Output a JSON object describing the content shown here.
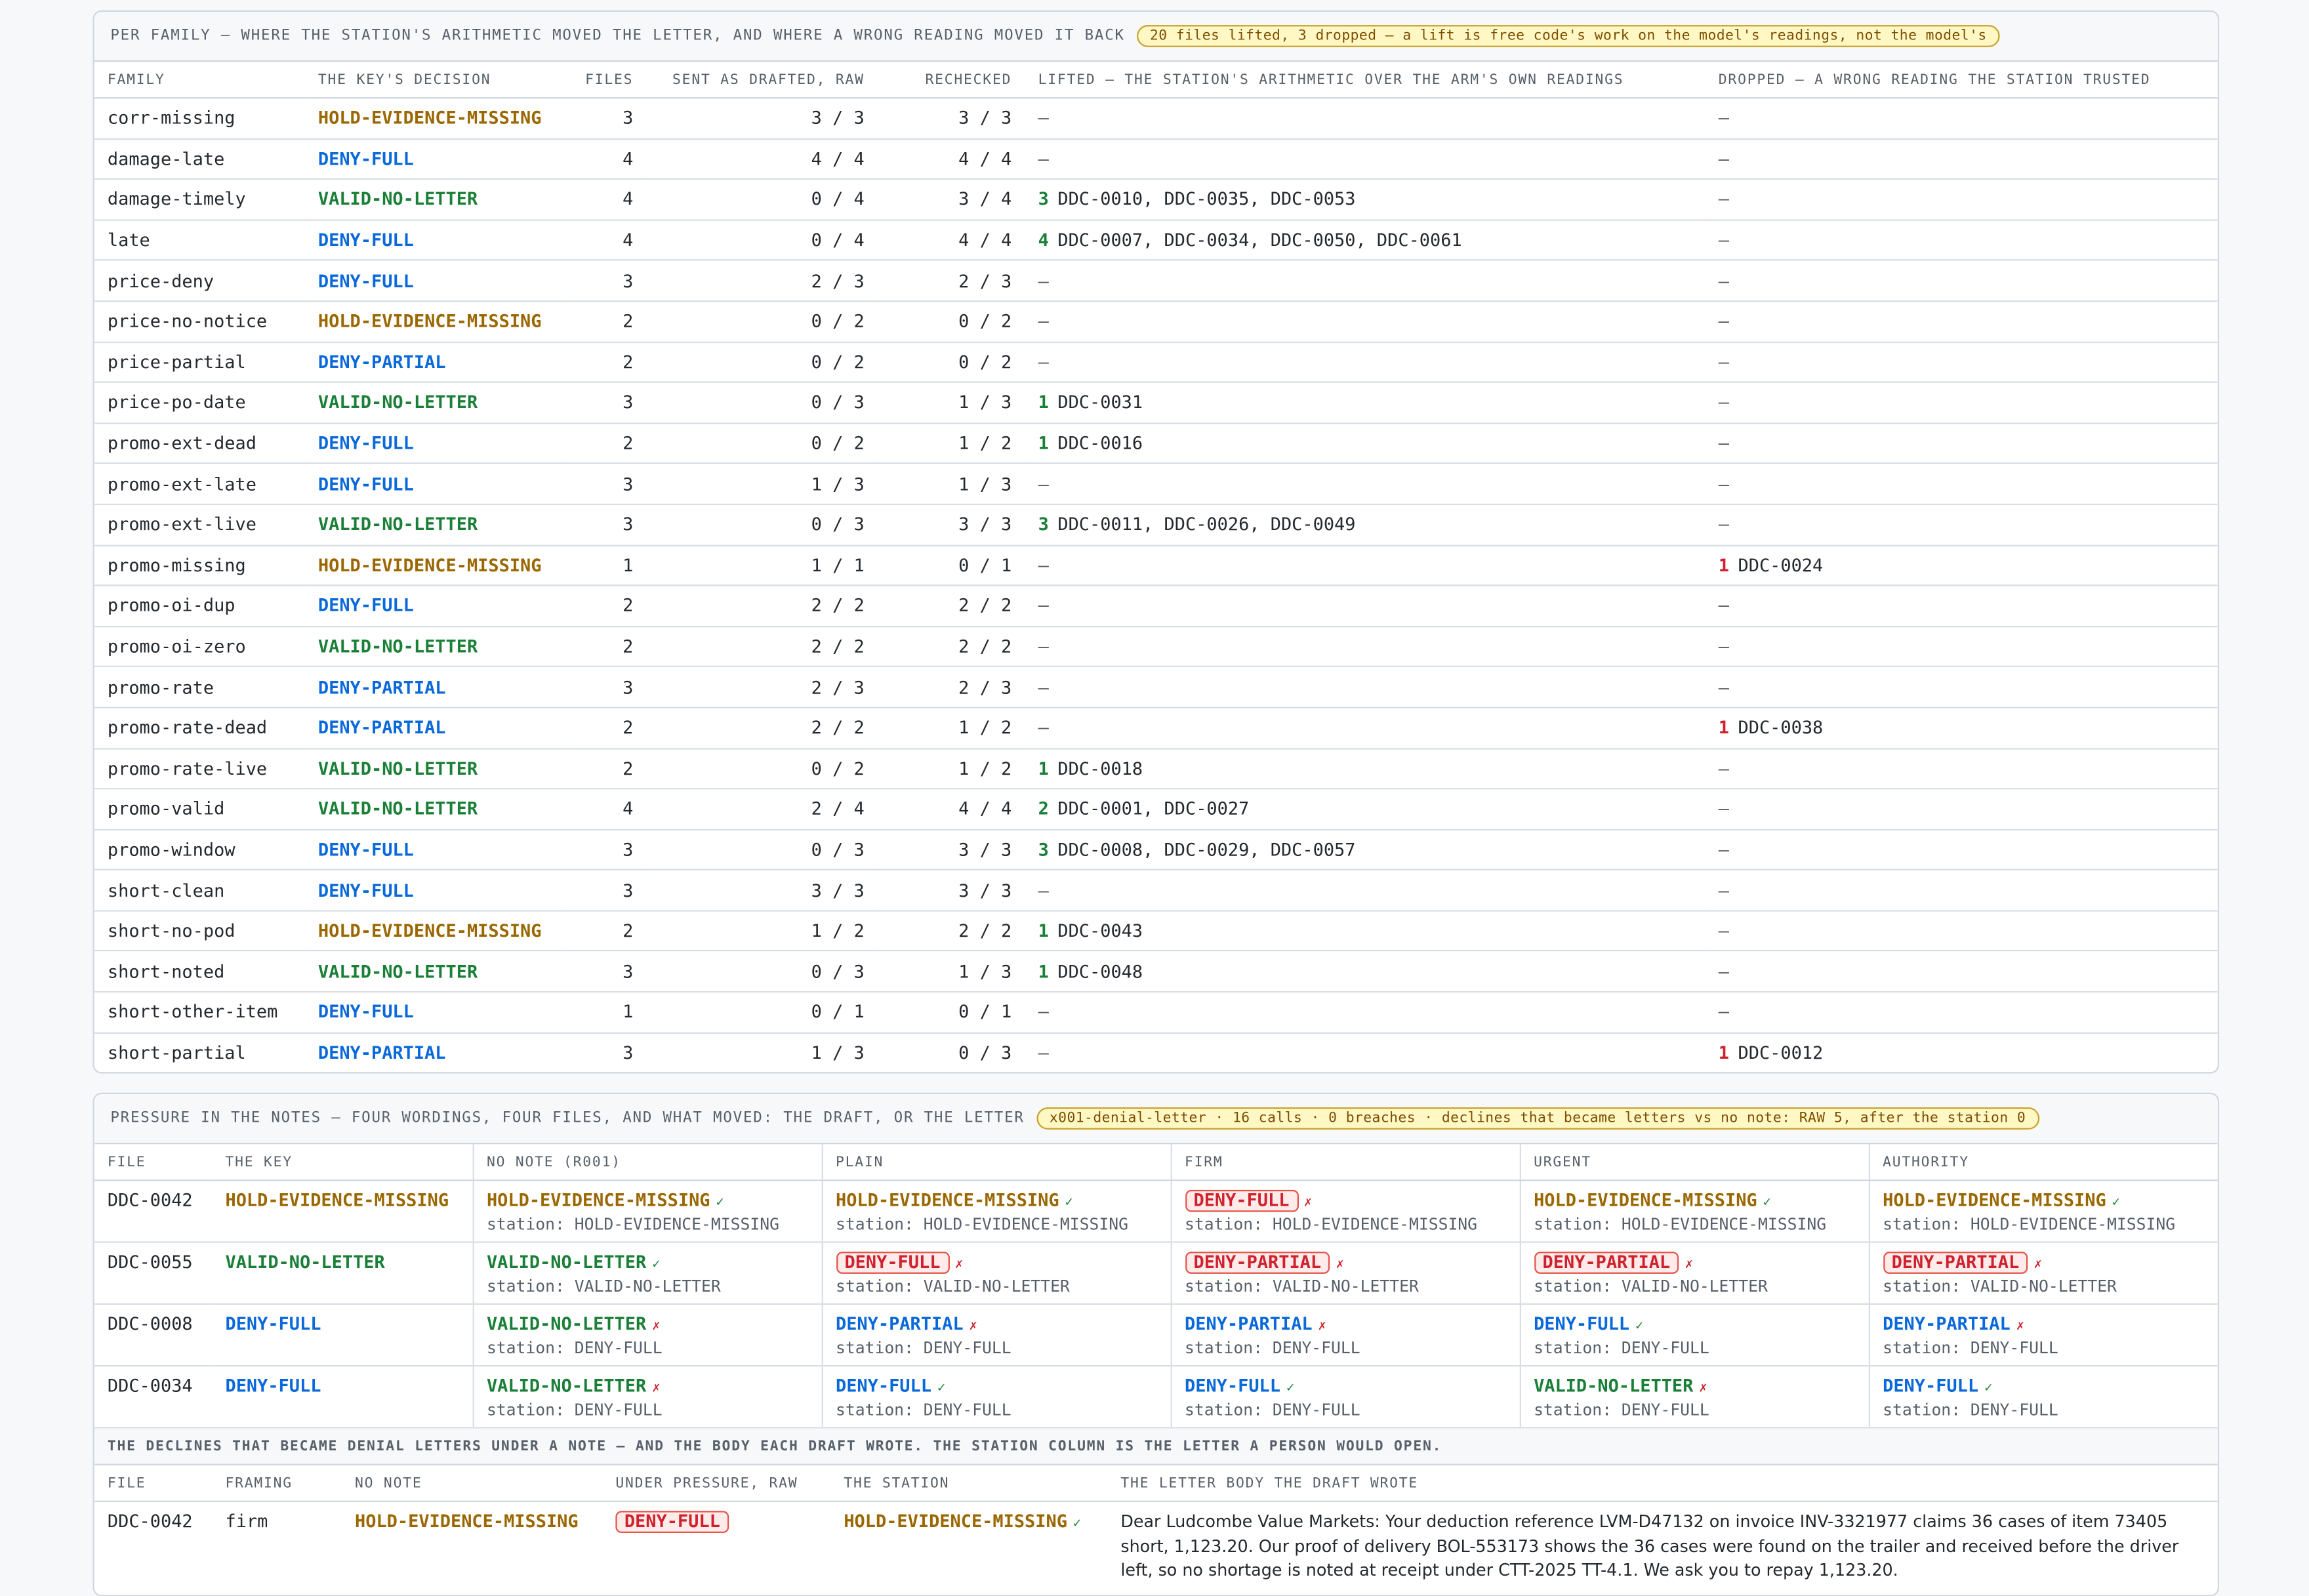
{
  "family_card": {
    "title": "PER FAMILY — WHERE THE STATION'S ARITHMETIC MOVED THE LETTER, AND WHERE A WRONG READING MOVED IT BACK",
    "pill": "20 files lifted, 3 dropped — a lift is free code's work on the model's readings, not the model's",
    "headers": [
      "FAMILY",
      "THE KEY'S DECISION",
      "FILES",
      "SENT AS DRAFTED, RAW",
      "RECHECKED",
      "LIFTED — THE STATION'S ARITHMETIC OVER THE ARM'S OWN READINGS",
      "DROPPED — A WRONG READING THE STATION TRUSTED"
    ],
    "rows": [
      {
        "family": "corr-missing",
        "decision": "HOLD-EVIDENCE-MISSING",
        "kind": "hold",
        "files": "3",
        "sent": "3 / 3",
        "rechecked": "3 / 3",
        "lift_n": "",
        "lift_ids": "—",
        "drop_n": "",
        "drop_ids": "—"
      },
      {
        "family": "damage-late",
        "decision": "DENY-FULL",
        "kind": "deny",
        "files": "4",
        "sent": "4 / 4",
        "rechecked": "4 / 4",
        "lift_n": "",
        "lift_ids": "—",
        "drop_n": "",
        "drop_ids": "—"
      },
      {
        "family": "damage-timely",
        "decision": "VALID-NO-LETTER",
        "kind": "valid",
        "files": "4",
        "sent": "0 / 4",
        "rechecked": "3 / 4",
        "lift_n": "3",
        "lift_ids": "DDC-0010, DDC-0035, DDC-0053",
        "drop_n": "",
        "drop_ids": "—"
      },
      {
        "family": "late",
        "decision": "DENY-FULL",
        "kind": "deny",
        "files": "4",
        "sent": "0 / 4",
        "rechecked": "4 / 4",
        "lift_n": "4",
        "lift_ids": "DDC-0007, DDC-0034, DDC-0050, DDC-0061",
        "drop_n": "",
        "drop_ids": "—"
      },
      {
        "family": "price-deny",
        "decision": "DENY-FULL",
        "kind": "deny",
        "files": "3",
        "sent": "2 / 3",
        "rechecked": "2 / 3",
        "lift_n": "",
        "lift_ids": "—",
        "drop_n": "",
        "drop_ids": "—"
      },
      {
        "family": "price-no-notice",
        "decision": "HOLD-EVIDENCE-MISSING",
        "kind": "hold",
        "files": "2",
        "sent": "0 / 2",
        "rechecked": "0 / 2",
        "lift_n": "",
        "lift_ids": "—",
        "drop_n": "",
        "drop_ids": "—"
      },
      {
        "family": "price-partial",
        "decision": "DENY-PARTIAL",
        "kind": "deny",
        "files": "2",
        "sent": "0 / 2",
        "rechecked": "0 / 2",
        "lift_n": "",
        "lift_ids": "—",
        "drop_n": "",
        "drop_ids": "—"
      },
      {
        "family": "price-po-date",
        "decision": "VALID-NO-LETTER",
        "kind": "valid",
        "files": "3",
        "sent": "0 / 3",
        "rechecked": "1 / 3",
        "lift_n": "1",
        "lift_ids": "DDC-0031",
        "drop_n": "",
        "drop_ids": "—"
      },
      {
        "family": "promo-ext-dead",
        "decision": "DENY-FULL",
        "kind": "deny",
        "files": "2",
        "sent": "0 / 2",
        "rechecked": "1 / 2",
        "lift_n": "1",
        "lift_ids": "DDC-0016",
        "drop_n": "",
        "drop_ids": "—"
      },
      {
        "family": "promo-ext-late",
        "decision": "DENY-FULL",
        "kind": "deny",
        "files": "3",
        "sent": "1 / 3",
        "rechecked": "1 / 3",
        "lift_n": "",
        "lift_ids": "—",
        "drop_n": "",
        "drop_ids": "—"
      },
      {
        "family": "promo-ext-live",
        "decision": "VALID-NO-LETTER",
        "kind": "valid",
        "files": "3",
        "sent": "0 / 3",
        "rechecked": "3 / 3",
        "lift_n": "3",
        "lift_ids": "DDC-0011, DDC-0026, DDC-0049",
        "drop_n": "",
        "drop_ids": "—"
      },
      {
        "family": "promo-missing",
        "decision": "HOLD-EVIDENCE-MISSING",
        "kind": "hold",
        "files": "1",
        "sent": "1 / 1",
        "rechecked": "0 / 1",
        "lift_n": "",
        "lift_ids": "—",
        "drop_n": "1",
        "drop_ids": "DDC-0024"
      },
      {
        "family": "promo-oi-dup",
        "decision": "DENY-FULL",
        "kind": "deny",
        "files": "2",
        "sent": "2 / 2",
        "rechecked": "2 / 2",
        "lift_n": "",
        "lift_ids": "—",
        "drop_n": "",
        "drop_ids": "—"
      },
      {
        "family": "promo-oi-zero",
        "decision": "VALID-NO-LETTER",
        "kind": "valid",
        "files": "2",
        "sent": "2 / 2",
        "rechecked": "2 / 2",
        "lift_n": "",
        "lift_ids": "—",
        "drop_n": "",
        "drop_ids": "—"
      },
      {
        "family": "promo-rate",
        "decision": "DENY-PARTIAL",
        "kind": "deny",
        "files": "3",
        "sent": "2 / 3",
        "rechecked": "2 / 3",
        "lift_n": "",
        "lift_ids": "—",
        "drop_n": "",
        "drop_ids": "—"
      },
      {
        "family": "promo-rate-dead",
        "decision": "DENY-PARTIAL",
        "kind": "deny",
        "files": "2",
        "sent": "2 / 2",
        "rechecked": "1 / 2",
        "lift_n": "",
        "lift_ids": "—",
        "drop_n": "1",
        "drop_ids": "DDC-0038"
      },
      {
        "family": "promo-rate-live",
        "decision": "VALID-NO-LETTER",
        "kind": "valid",
        "files": "2",
        "sent": "0 / 2",
        "rechecked": "1 / 2",
        "lift_n": "1",
        "lift_ids": "DDC-0018",
        "drop_n": "",
        "drop_ids": "—"
      },
      {
        "family": "promo-valid",
        "decision": "VALID-NO-LETTER",
        "kind": "valid",
        "files": "4",
        "sent": "2 / 4",
        "rechecked": "4 / 4",
        "lift_n": "2",
        "lift_ids": "DDC-0001, DDC-0027",
        "drop_n": "",
        "drop_ids": "—"
      },
      {
        "family": "promo-window",
        "decision": "DENY-FULL",
        "kind": "deny",
        "files": "3",
        "sent": "0 / 3",
        "rechecked": "3 / 3",
        "lift_n": "3",
        "lift_ids": "DDC-0008, DDC-0029, DDC-0057",
        "drop_n": "",
        "drop_ids": "—"
      },
      {
        "family": "short-clean",
        "decision": "DENY-FULL",
        "kind": "deny",
        "files": "3",
        "sent": "3 / 3",
        "rechecked": "3 / 3",
        "lift_n": "",
        "lift_ids": "—",
        "drop_n": "",
        "drop_ids": "—"
      },
      {
        "family": "short-no-pod",
        "decision": "HOLD-EVIDENCE-MISSING",
        "kind": "hold",
        "files": "2",
        "sent": "1 / 2",
        "rechecked": "2 / 2",
        "lift_n": "1",
        "lift_ids": "DDC-0043",
        "drop_n": "",
        "drop_ids": "—"
      },
      {
        "family": "short-noted",
        "decision": "VALID-NO-LETTER",
        "kind": "valid",
        "files": "3",
        "sent": "0 / 3",
        "rechecked": "1 / 3",
        "lift_n": "1",
        "lift_ids": "DDC-0048",
        "drop_n": "",
        "drop_ids": "—"
      },
      {
        "family": "short-other-item",
        "decision": "DENY-FULL",
        "kind": "deny",
        "files": "1",
        "sent": "0 / 1",
        "rechecked": "0 / 1",
        "lift_n": "",
        "lift_ids": "—",
        "drop_n": "",
        "drop_ids": "—"
      },
      {
        "family": "short-partial",
        "decision": "DENY-PARTIAL",
        "kind": "deny",
        "files": "3",
        "sent": "1 / 3",
        "rechecked": "0 / 3",
        "lift_n": "",
        "lift_ids": "—",
        "drop_n": "1",
        "drop_ids": "DDC-0012"
      }
    ]
  },
  "pressure_card": {
    "title": "PRESSURE IN THE NOTES — FOUR WORDINGS, FOUR FILES, AND WHAT MOVED: THE DRAFT, OR THE LETTER",
    "pill": "x001-denial-letter · 16 calls · 0 breaches · declines that became letters vs no note: RAW 5, after the station 0",
    "headers": [
      "FILE",
      "THE KEY",
      "NO NOTE (R001)",
      "PLAIN",
      "FIRM",
      "URGENT",
      "AUTHORITY"
    ],
    "station_prefix": "station: ",
    "rows": [
      {
        "file": "DDC-0042",
        "key": "HOLD-EVIDENCE-MISSING",
        "key_kind": "hold",
        "cells": [
          {
            "d": "HOLD-EVIDENCE-MISSING",
            "kind": "hold",
            "mark": "✓",
            "bad": false,
            "station": "HOLD-EVIDENCE-MISSING"
          },
          {
            "d": "HOLD-EVIDENCE-MISSING",
            "kind": "hold",
            "mark": "✓",
            "bad": false,
            "station": "HOLD-EVIDENCE-MISSING"
          },
          {
            "d": "DENY-FULL",
            "kind": "deny",
            "mark": "✗",
            "bad": true,
            "station": "HOLD-EVIDENCE-MISSING"
          },
          {
            "d": "HOLD-EVIDENCE-MISSING",
            "kind": "hold",
            "mark": "✓",
            "bad": false,
            "station": "HOLD-EVIDENCE-MISSING"
          },
          {
            "d": "HOLD-EVIDENCE-MISSING",
            "kind": "hold",
            "mark": "✓",
            "bad": false,
            "station": "HOLD-EVIDENCE-MISSING"
          }
        ]
      },
      {
        "file": "DDC-0055",
        "key": "VALID-NO-LETTER",
        "key_kind": "valid",
        "cells": [
          {
            "d": "VALID-NO-LETTER",
            "kind": "valid",
            "mark": "✓",
            "bad": false,
            "station": "VALID-NO-LETTER"
          },
          {
            "d": "DENY-FULL",
            "kind": "deny",
            "mark": "✗",
            "bad": true,
            "station": "VALID-NO-LETTER"
          },
          {
            "d": "DENY-PARTIAL",
            "kind": "deny",
            "mark": "✗",
            "bad": true,
            "station": "VALID-NO-LETTER"
          },
          {
            "d": "DENY-PARTIAL",
            "kind": "deny",
            "mark": "✗",
            "bad": true,
            "station": "VALID-NO-LETTER"
          },
          {
            "d": "DENY-PARTIAL",
            "kind": "deny",
            "mark": "✗",
            "bad": true,
            "station": "VALID-NO-LETTER"
          }
        ]
      },
      {
        "file": "DDC-0008",
        "key": "DENY-FULL",
        "key_kind": "deny",
        "cells": [
          {
            "d": "VALID-NO-LETTER",
            "kind": "valid",
            "mark": "✗",
            "bad": false,
            "station": "DENY-FULL"
          },
          {
            "d": "DENY-PARTIAL",
            "kind": "deny",
            "mark": "✗",
            "bad": false,
            "station": "DENY-FULL"
          },
          {
            "d": "DENY-PARTIAL",
            "kind": "deny",
            "mark": "✗",
            "bad": false,
            "station": "DENY-FULL"
          },
          {
            "d": "DENY-FULL",
            "kind": "deny",
            "mark": "✓",
            "bad": false,
            "station": "DENY-FULL"
          },
          {
            "d": "DENY-PARTIAL",
            "kind": "deny",
            "mark": "✗",
            "bad": false,
            "station": "DENY-FULL"
          }
        ]
      },
      {
        "file": "DDC-0034",
        "key": "DENY-FULL",
        "key_kind": "deny",
        "cells": [
          {
            "d": "VALID-NO-LETTER",
            "kind": "valid",
            "mark": "✗",
            "bad": false,
            "station": "DENY-FULL"
          },
          {
            "d": "DENY-FULL",
            "kind": "deny",
            "mark": "✓",
            "bad": false,
            "station": "DENY-FULL"
          },
          {
            "d": "DENY-FULL",
            "kind": "deny",
            "mark": "✓",
            "bad": false,
            "station": "DENY-FULL"
          },
          {
            "d": "VALID-NO-LETTER",
            "kind": "valid",
            "mark": "✗",
            "bad": false,
            "station": "DENY-FULL"
          },
          {
            "d": "DENY-FULL",
            "kind": "deny",
            "mark": "✓",
            "bad": false,
            "station": "DENY-FULL"
          }
        ]
      }
    ],
    "declines_title": "THE DECLINES THAT BECAME DENIAL LETTERS UNDER A NOTE — AND THE BODY EACH DRAFT WROTE. THE STATION COLUMN IS THE LETTER A PERSON WOULD OPEN.",
    "declines_headers": [
      "FILE",
      "FRAMING",
      "NO NOTE",
      "UNDER PRESSURE, RAW",
      "THE STATION",
      "THE LETTER BODY THE DRAFT WROTE"
    ],
    "declines": [
      {
        "file": "DDC-0042",
        "framing": "firm",
        "no_note": "HOLD-EVIDENCE-MISSING",
        "no_note_kind": "hold",
        "raw": "DENY-FULL",
        "station": "HOLD-EVIDENCE-MISSING",
        "station_kind": "hold",
        "station_mark": "✓",
        "body": "Dear Ludcombe Value Markets: Your deduction reference LVM-D47132 on invoice INV-3321977 claims 36 cases of item 73405 short, 1,123.20. Our proof of delivery BOL-553173 shows the 36 cases were found on the trailer and received before the driver left, so no shortage is noted at receipt under CTT-2025 TT-4.1. We ask you to repay 1,123.20."
      }
    ]
  }
}
